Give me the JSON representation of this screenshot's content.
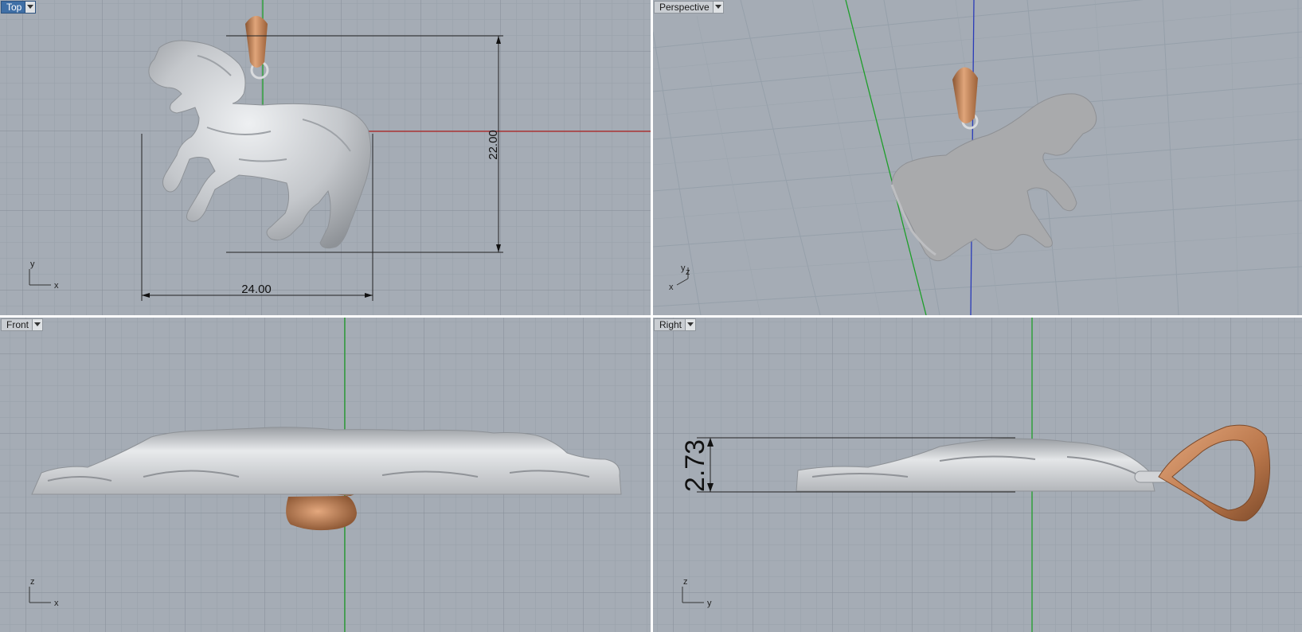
{
  "viewports": {
    "top": {
      "label": "Top",
      "dimensions": {
        "width": "24.00",
        "height": "22.00"
      },
      "axes": {
        "h": "x",
        "v": "y"
      }
    },
    "perspective": {
      "label": "Perspective",
      "axes": {
        "h": "x",
        "v": "y",
        "z": "z"
      }
    },
    "front": {
      "label": "Front",
      "axes": {
        "h": "x",
        "v": "z"
      }
    },
    "right": {
      "label": "Right",
      "dimensions": {
        "thickness": "2.73"
      },
      "axes": {
        "h": "y",
        "v": "z"
      }
    }
  },
  "colors": {
    "background": "#a5acb5",
    "grid_minor": "#98a0a9",
    "grid_major": "#8a929c",
    "x_axis": "#b22222",
    "y_axis": "#1e9e2a",
    "z_axis": "#2a3bb8",
    "silver": "#c8cacd",
    "gold": "#c98a5e",
    "active_label": "#3f6fa6"
  },
  "icons": [
    "dropdown-arrow-icon",
    "axis-widget-icon"
  ]
}
